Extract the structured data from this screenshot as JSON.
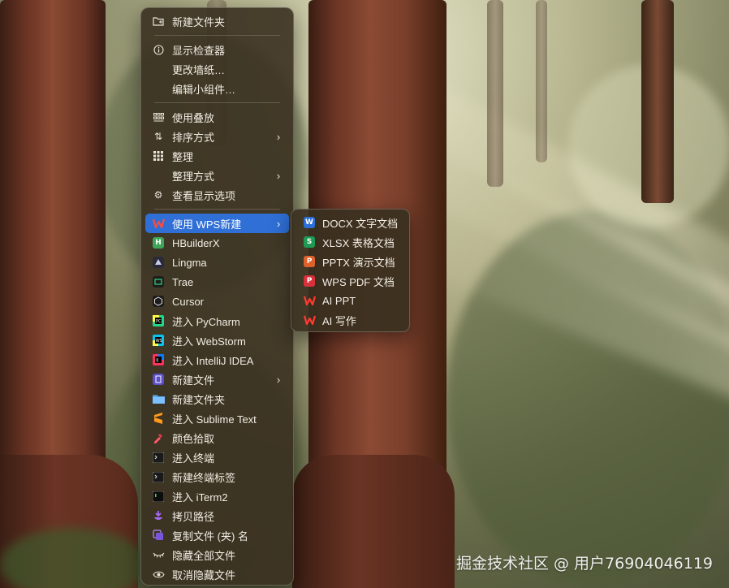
{
  "menu": {
    "items": [
      {
        "label": "新建文件夹",
        "icon": "folder-plus-icon"
      },
      {
        "label": "显示检查器",
        "icon": "info-icon"
      },
      {
        "label": "更改墙纸…",
        "icon": ""
      },
      {
        "label": "编辑小组件…",
        "icon": ""
      },
      {
        "label": "使用叠放",
        "icon": "stack-grid-icon"
      },
      {
        "label": "排序方式",
        "icon": "sort-arrows-icon",
        "submenu": true
      },
      {
        "label": "整理",
        "icon": "grid-icon"
      },
      {
        "label": "整理方式",
        "icon": "",
        "submenu": true
      },
      {
        "label": "查看显示选项",
        "icon": "gear-icon"
      },
      {
        "label": "使用 WPS新建",
        "icon": "wps-icon",
        "submenu": true,
        "highlighted": true
      },
      {
        "label": "HBuilderX",
        "icon": "hbuilderx-icon"
      },
      {
        "label": "Lingma",
        "icon": "lingma-icon"
      },
      {
        "label": "Trae",
        "icon": "trae-icon"
      },
      {
        "label": "Cursor",
        "icon": "cursor-icon"
      },
      {
        "label": "进入 PyCharm",
        "icon": "pycharm-icon"
      },
      {
        "label": "进入 WebStorm",
        "icon": "webstorm-icon"
      },
      {
        "label": "进入 IntelliJ IDEA",
        "icon": "intellij-icon"
      },
      {
        "label": "新建文件",
        "icon": "new-file-icon",
        "submenu": true
      },
      {
        "label": "新建文件夹",
        "icon": "blue-folder-icon"
      },
      {
        "label": "进入 Sublime Text",
        "icon": "sublime-icon"
      },
      {
        "label": "颜色拾取",
        "icon": "color-picker-icon"
      },
      {
        "label": "进入终端",
        "icon": "terminal-icon"
      },
      {
        "label": "新建终端标签",
        "icon": "terminal-tab-icon"
      },
      {
        "label": "进入 iTerm2",
        "icon": "iterm2-icon"
      },
      {
        "label": "拷贝路径",
        "icon": "copy-path-icon"
      },
      {
        "label": "复制文件 (夹) 名",
        "icon": "copy-name-icon"
      },
      {
        "label": "隐藏全部文件",
        "icon": "eye-closed-icon"
      },
      {
        "label": "取消隐藏文件",
        "icon": "eye-icon"
      }
    ]
  },
  "submenu": {
    "items": [
      {
        "label": "DOCX 文字文档",
        "icon": "docx-icon",
        "letter": "W",
        "color": "#2b6fd8"
      },
      {
        "label": "XLSX 表格文档",
        "icon": "xlsx-icon",
        "letter": "S",
        "color": "#1f9a55"
      },
      {
        "label": "PPTX 演示文档",
        "icon": "pptx-icon",
        "letter": "P",
        "color": "#e0602a"
      },
      {
        "label": "WPS PDF 文档",
        "icon": "pdf-icon",
        "letter": "P",
        "color": "#d8313a"
      },
      {
        "label": "AI PPT",
        "icon": "wps-ai-icon",
        "letter": "W",
        "color": "#e8342e"
      },
      {
        "label": "AI 写作",
        "icon": "wps-ai-write-icon",
        "letter": "W",
        "color": "#e8342e"
      }
    ]
  },
  "watermark": "掘金技术社区 @ 用户76904046119"
}
